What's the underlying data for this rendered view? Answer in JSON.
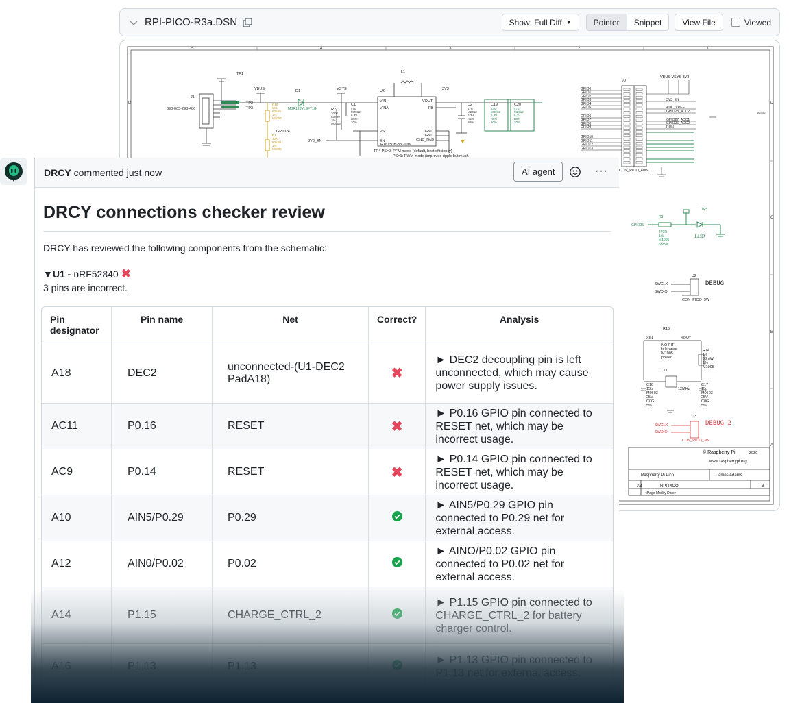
{
  "file_header": {
    "file_name": "RPI-PICO-R3a.DSN",
    "show_label": "Show: Full Diff",
    "tabs": [
      "Pointer",
      "Snippet"
    ],
    "view_file_label": "View File",
    "viewed_label": "Viewed"
  },
  "schematic": {
    "col_numbers": [
      "5",
      "4",
      "3",
      "2",
      "1"
    ],
    "row_letters": [
      "D",
      "C",
      "B",
      "A"
    ],
    "labels": {
      "j1": "J1",
      "j1_part": "690-005-298-486",
      "tp1": "TP1",
      "tp2": "TP2",
      "tp3": "TP3",
      "vbus": "VBUS",
      "d1": "D1",
      "d1_part": "MBR120VLSFT1G",
      "vsys": "VSYS",
      "u2": "U2",
      "l1": "L1",
      "u2_vin": "VIN",
      "u2_vina": "VINA",
      "u2_ps": "PS",
      "u2_en": "EN",
      "u2_vout": "VOUT",
      "u2_fb": "FB",
      "u2_gnd": "GND",
      "u2_gnd_pad": "GND_PAD",
      "u2_part": "RT6150B-33GQW",
      "v3": "3V3",
      "v3_en": "3V3_EN",
      "gpio24": "GPIO24",
      "tp4_note_1": "TP4  PS=0: PFM mode (default, best efficiency)",
      "tp4_note_2": "PS=1: PWM mode (improved ripple but much",
      "r2": "R2",
      "c1": "C1",
      "c2": "C2",
      "c19": "C19",
      "c20": "C20",
      "j0": "J0",
      "j0_part": "CON_PICO_40W",
      "top_nets": "VBUS VSYS  3V3",
      "gpio_left": [
        "GPIO0",
        "GPIO1",
        "GPIO2",
        "GPIO3",
        "GPIO4",
        "GPIO5",
        "GPIO6",
        "GPIO7",
        "GPIO8",
        "GPIO9",
        "GPIO10",
        "GPIO11",
        "GPIO12",
        "GPIO13"
      ],
      "right_nets": [
        "3V3_EN",
        "ADC_VREF",
        "GPIO28_ADC2",
        "GPIO27_ADC1",
        "GPIO26_ADC0",
        "RUN"
      ],
      "agnd": "AGND",
      "r3": "R3",
      "r3_val": "470R",
      "gpio25": "GPIO25",
      "tp5": "TP5",
      "led": "LED",
      "j2": "J2",
      "swclk": "SWCLK",
      "swdio": "SWDIO",
      "debug": "DEBUG",
      "con_pico_3w": "CON_PICO_3W",
      "r15": "R15",
      "xin": "XIN",
      "xout": "XOUT",
      "nofit": "NO-FIT",
      "tolerance": "tolerance",
      "r14": "R14",
      "x1": "X1",
      "freq": "12MHz",
      "c16": "C16",
      "c17": "C17",
      "j3": "J3",
      "debug2": "DEBUG 2",
      "copyright": "© Raspberry Pi",
      "year": "2020",
      "website": "www.raspberrypi.org",
      "title_value": "Raspberry Pi Pico",
      "drawn_by": "James Adams",
      "size": "A3",
      "ref": "RPI-PICO",
      "rev": "3",
      "date": "<Page Modify Date>"
    }
  },
  "comment": {
    "author": "DRCY",
    "action": "commented just now",
    "ai_badge": "AI agent",
    "title": "DRCY connections checker review",
    "intro": "DRCY has reviewed the following components from the schematic:",
    "component_ref": "U1 -",
    "component_part": "nRF52840",
    "component_toggle": "▼",
    "component_status": "✖",
    "pins_note": "3 pins are incorrect.",
    "table": {
      "headers": [
        "Pin designator",
        "Pin name",
        "Net",
        "Correct?",
        "Analysis"
      ],
      "rows": [
        {
          "designator": "A18",
          "name": "DEC2",
          "net": "unconnected-(U1-DEC2 PadA18)",
          "correct": false,
          "analysis": "► DEC2 decoupling pin is left unconnected, which may cause power supply issues."
        },
        {
          "designator": "AC11",
          "name": "P0.16",
          "net": "RESET",
          "correct": false,
          "analysis": "► P0.16 GPIO pin connected to RESET net, which may be incorrect usage."
        },
        {
          "designator": "AC9",
          "name": "P0.14",
          "net": "RESET",
          "correct": false,
          "analysis": "► P0.14 GPIO pin connected to RESET net, which may be incorrect usage."
        },
        {
          "designator": "A10",
          "name": "AIN5/P0.29",
          "net": "P0.29",
          "correct": true,
          "analysis": "► AIN5/P0.29 GPIO pin connected to P0.29 net for external access."
        },
        {
          "designator": "A12",
          "name": "AIN0/P0.02",
          "net": "P0.02",
          "correct": true,
          "analysis": "► AINO/P0.02 GPIO pin connected to P0.02 net for external access."
        },
        {
          "designator": "A14",
          "name": "P1.15",
          "net": "CHARGE_CTRL_2",
          "correct": true,
          "analysis": "► P1.15 GPIO pin connected to CHARGE_CTRL_2 for battery charger control."
        },
        {
          "designator": "A16",
          "name": "P1.13",
          "net": "P1.13",
          "correct": true,
          "analysis": "► P1.13 GPIO pin connected to P1.13 net for external access."
        }
      ]
    }
  },
  "colors": {
    "accent_green": "#16a34a",
    "error_red": "#e5455b",
    "schematic_gold": "#c9a227",
    "schematic_green": "#2e8b57",
    "schematic_red": "#d63b3b"
  }
}
